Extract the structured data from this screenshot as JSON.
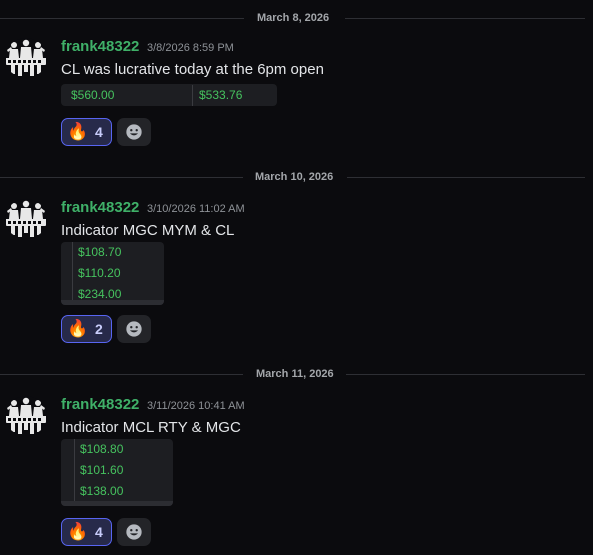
{
  "messages": [
    {
      "date_divider": "March 8, 2026",
      "username": "frank48322",
      "timestamp": "3/8/2026 8:59 PM",
      "text": "CL was lucrative today at the 6pm open",
      "values": [
        "$560.00",
        "$533.76"
      ],
      "reaction": {
        "emoji": "🔥",
        "count": "4"
      }
    },
    {
      "date_divider": "March 10, 2026",
      "username": "frank48322",
      "timestamp": "3/10/2026 11:02 AM",
      "text": "Indicator MGC MYM & CL",
      "values": [
        "$108.70",
        "$110.20",
        "$234.00"
      ],
      "reaction": {
        "emoji": "🔥",
        "count": "2"
      }
    },
    {
      "date_divider": "March 11, 2026",
      "username": "frank48322",
      "timestamp": "3/11/2026 10:41 AM",
      "text": "Indicator MCL RTY & MGC",
      "values": [
        "$108.80",
        "$101.60",
        "$138.00"
      ],
      "reaction": {
        "emoji": "🔥",
        "count": "4"
      }
    }
  ],
  "icons": {
    "avatar": "silhouette-group-avatar",
    "add_reaction": "smiley-face-icon",
    "reaction_emoji": "fire-emoji"
  },
  "colors": {
    "background": "#0b0b0e",
    "username": "#3fb068",
    "value_text": "#46c35f",
    "reaction_border": "#5865f2",
    "reaction_bg": "#272a4a"
  }
}
